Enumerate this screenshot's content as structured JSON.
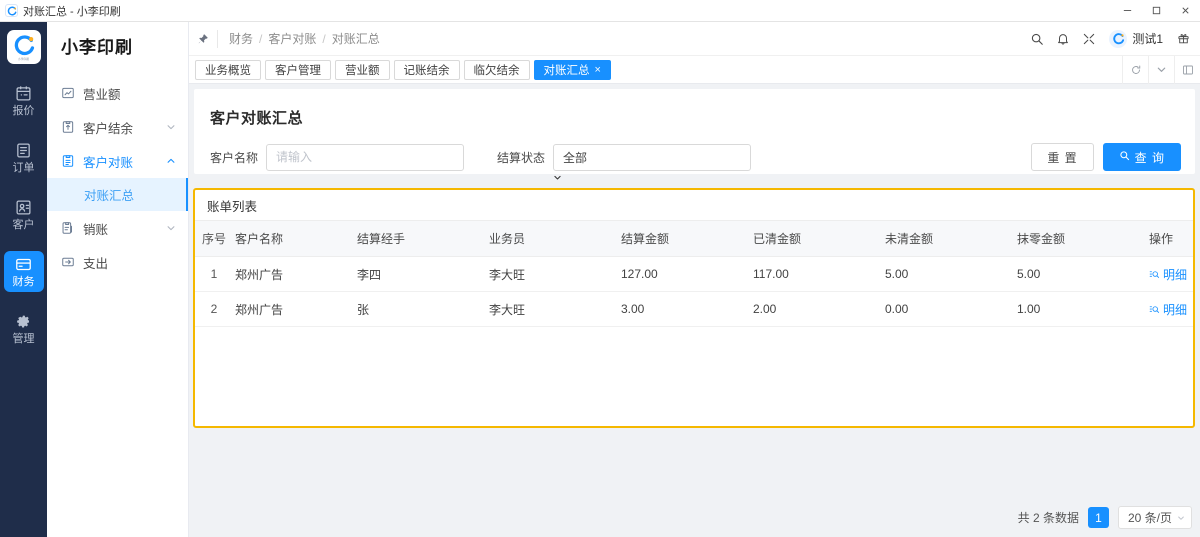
{
  "window": {
    "title": "对账汇总 - 小李印刷",
    "logo_icon": "app-logo-icon",
    "minimize_icon": "minimize-icon",
    "maximize_icon": "maximize-icon",
    "close_icon": "close-icon"
  },
  "rail": {
    "logo_text": "小李印刷",
    "items": [
      {
        "label": "报价",
        "icon": "quote-icon",
        "active": false
      },
      {
        "label": "订单",
        "icon": "order-icon",
        "active": false
      },
      {
        "label": "客户",
        "icon": "customer-icon",
        "active": false
      },
      {
        "label": "财务",
        "icon": "finance-icon",
        "active": true
      },
      {
        "label": "管理",
        "icon": "settings-gear-icon",
        "active": false
      }
    ]
  },
  "sidebar": {
    "brand": "小李印刷",
    "items": [
      {
        "label": "营业额",
        "icon": "revenue-chart-icon",
        "expandable": false,
        "expanded": false
      },
      {
        "label": "客户结余",
        "icon": "balance-icon",
        "expandable": true,
        "expanded": false
      },
      {
        "label": "客户对账",
        "icon": "reconcile-icon",
        "expandable": true,
        "expanded": true
      }
    ],
    "submenu": [
      {
        "label": "对账汇总",
        "active": true
      }
    ],
    "items_after": [
      {
        "label": "销账",
        "icon": "writeoff-icon",
        "expandable": true,
        "expanded": false
      },
      {
        "label": "支出",
        "icon": "expense-icon",
        "expandable": false,
        "expanded": false
      }
    ]
  },
  "header": {
    "pin_icon": "pin-icon",
    "breadcrumb": [
      "财务",
      "客户对账",
      "对账汇总"
    ],
    "separator": "/",
    "icons": [
      "search-icon",
      "bell-icon",
      "fullscreen-icon"
    ],
    "user_name": "测试1",
    "avatar_icon": "avatar-icon",
    "gift_icon": "gift-icon"
  },
  "tabs": {
    "items": [
      {
        "label": "业务概览",
        "active": false,
        "closable": false
      },
      {
        "label": "客户管理",
        "active": false,
        "closable": false
      },
      {
        "label": "营业额",
        "active": false,
        "closable": false
      },
      {
        "label": "记账结余",
        "active": false,
        "closable": false
      },
      {
        "label": "临欠结余",
        "active": false,
        "closable": false
      },
      {
        "label": "对账汇总",
        "active": true,
        "closable": true
      }
    ],
    "close_glyph": "×",
    "tools": [
      "refresh-icon",
      "chevron-down-icon",
      "layout-icon"
    ]
  },
  "page": {
    "title": "客户对账汇总",
    "filters": {
      "customer_name_label": "客户名称",
      "customer_name_value": "",
      "customer_name_placeholder": "请输入",
      "settle_status_label": "结算状态",
      "settle_status_value": "全部"
    },
    "buttons": {
      "reset": "重 置",
      "query": "查 询",
      "query_icon": "search-icon"
    }
  },
  "list": {
    "title": "账单列表",
    "columns": [
      "序号",
      "客户名称",
      "结算经手",
      "业务员",
      "结算金额",
      "已清金额",
      "未清金额",
      "抹零金额",
      "操作"
    ],
    "rows": [
      {
        "index": "1",
        "customer": "郑州广告",
        "handler": "李四",
        "salesman": "李大旺",
        "settle_amount": "127.00",
        "cleared_amount": "117.00",
        "uncleared_amount": "5.00",
        "rounding_amount": "5.00",
        "action": "明细",
        "action_icon": "detail-search-icon"
      },
      {
        "index": "2",
        "customer": "郑州广告",
        "handler": "张",
        "salesman": "李大旺",
        "settle_amount": "3.00",
        "cleared_amount": "2.00",
        "uncleared_amount": "0.00",
        "rounding_amount": "1.00",
        "action": "明细",
        "action_icon": "detail-search-icon"
      }
    ]
  },
  "pagination": {
    "total_text": "共 2 条数据",
    "current_page": "1",
    "page_size": "20 条/页"
  },
  "colors": {
    "primary": "#1890ff",
    "rail_bg": "#1f2d4a",
    "highlight_border": "#f5b800",
    "submenu_active_bg": "#e6f3ff",
    "page_bg": "#f0f2f5"
  }
}
